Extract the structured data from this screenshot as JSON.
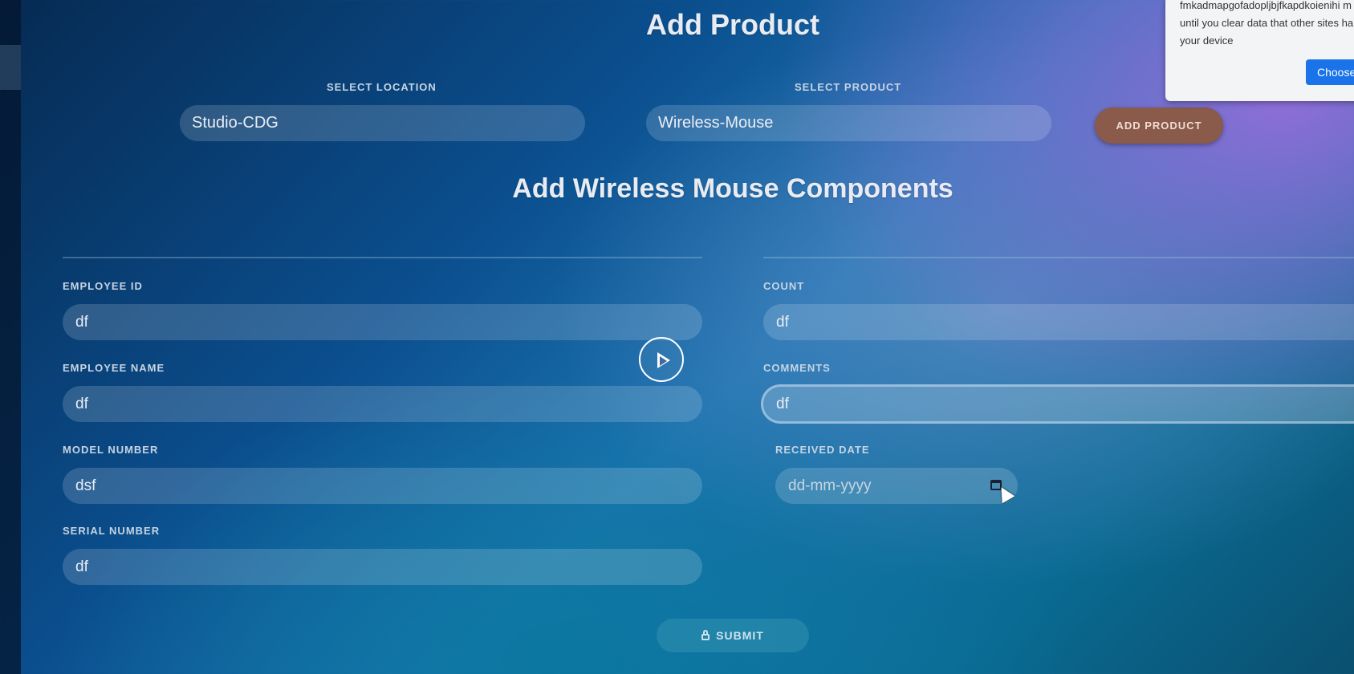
{
  "page": {
    "title": "Add Product",
    "subtitle": "Add Wireless Mouse Components"
  },
  "selection": {
    "location_label": "SELECT LOCATION",
    "location_value": "Studio-CDG",
    "product_label": "SELECT PRODUCT",
    "product_value": "Wireless-Mouse",
    "add_button": "ADD PRODUCT"
  },
  "form": {
    "left": [
      {
        "label": "EMPLOYEE ID",
        "value": "df"
      },
      {
        "label": "EMPLOYEE NAME",
        "value": "df"
      },
      {
        "label": "MODEL NUMBER",
        "value": "dsf"
      },
      {
        "label": "SERIAL NUMBER",
        "value": "df"
      }
    ],
    "right": [
      {
        "label": "COUNT",
        "value": "df"
      },
      {
        "label": "COMMENTS",
        "value": "df"
      }
    ],
    "received_date": {
      "label": "RECEIVED DATE",
      "placeholder": "dd-mm-yyyy"
    },
    "submit": "SUBMIT"
  },
  "popup": {
    "text": "fmkadmapgofadopljbjfkapdkoienihi m\nuntil you clear data that other sites ha\nyour device",
    "button": "Choose"
  },
  "icons": {
    "play": "play-icon",
    "calendar": "calendar-icon",
    "lock": "lock-icon",
    "cursor": "mouse-cursor"
  }
}
